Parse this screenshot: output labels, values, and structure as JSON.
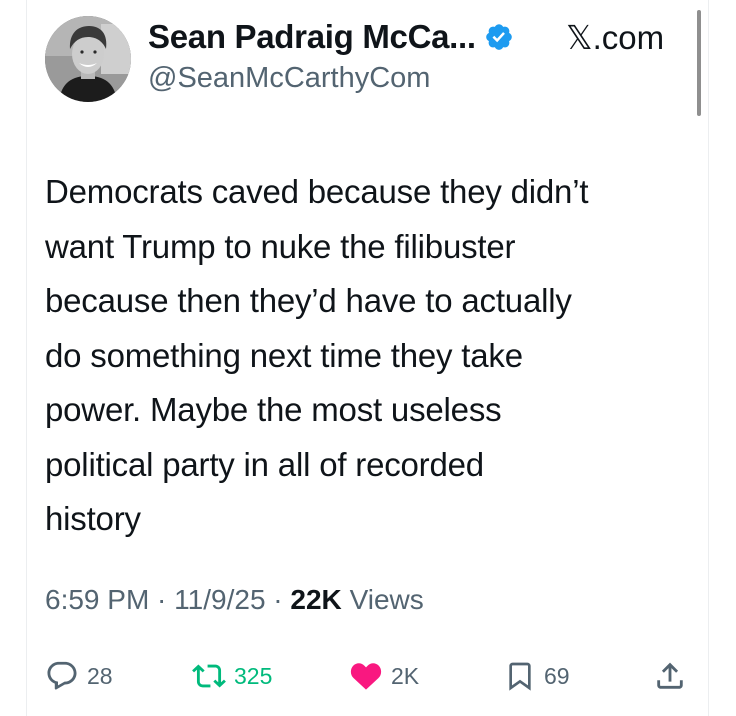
{
  "author": {
    "display_name": "Sean Padraig McCa...",
    "handle": "@SeanMcCarthyCom",
    "verified": true
  },
  "site_label": "𝕏.com",
  "tweet": {
    "lines": [
      "Democrats caved because they didn’t",
      "want Trump to nuke the filibuster",
      "because then they’d have to actually",
      "do something next time they take",
      "power. Maybe the most useless",
      "political party in all of recorded",
      "history"
    ]
  },
  "meta": {
    "time": "6:59 PM",
    "date": "11/9/25",
    "views_count": "22K",
    "views_label": "Views"
  },
  "actions": {
    "replies": "28",
    "reposts": "325",
    "likes": "2K",
    "bookmarks": "69"
  },
  "colors": {
    "verified": "#1d9bf0",
    "repost": "#00ba7c",
    "like": "#f91880",
    "muted": "#536471",
    "text": "#0f1419"
  },
  "icons": {
    "reply": "speech-bubble-icon",
    "repost": "retweet-arrows-icon",
    "like": "heart-icon",
    "bookmark": "bookmark-icon",
    "share": "share-upload-icon",
    "verified": "verified-badge-icon"
  }
}
